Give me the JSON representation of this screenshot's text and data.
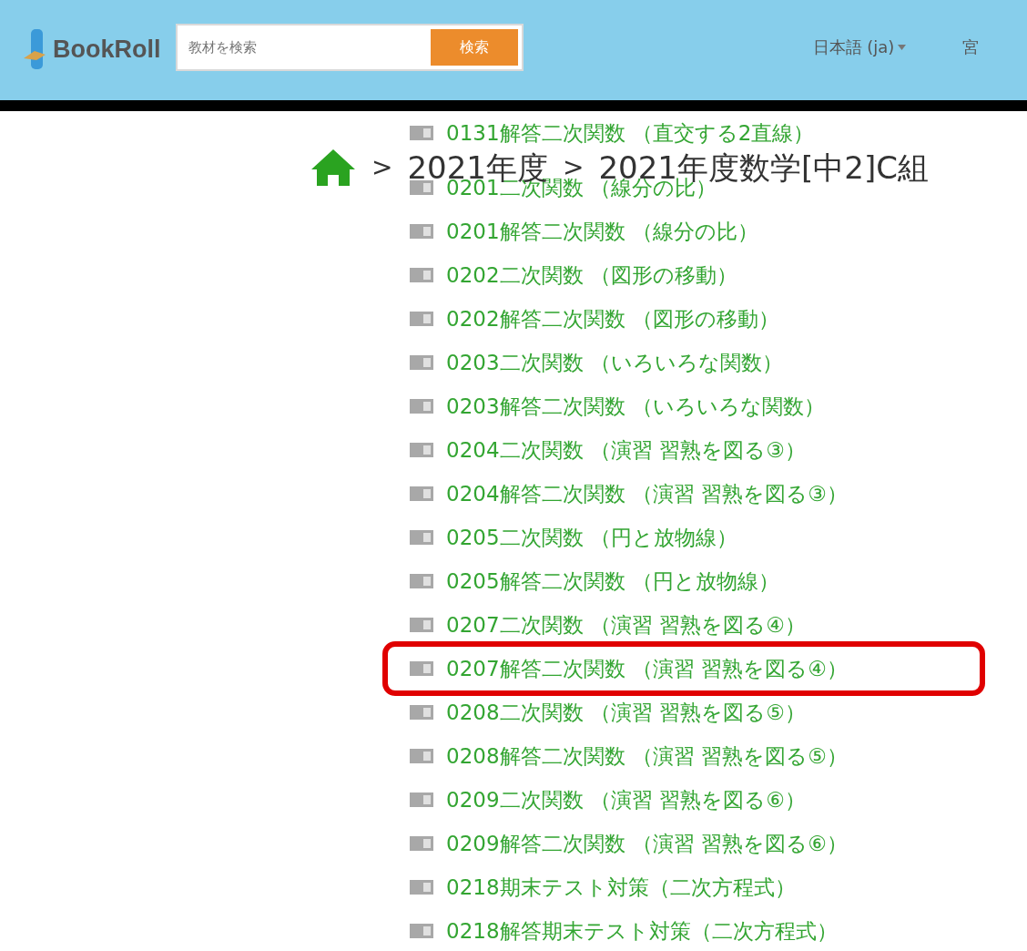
{
  "header": {
    "logo": "BookRoll",
    "search": {
      "placeholder": "教材を検索",
      "button": "検索"
    },
    "language": "日本語 (ja)",
    "user": "宮"
  },
  "breadcrumb": [
    {
      "separator": ">",
      "label": "2021年度"
    },
    {
      "separator": ">",
      "label": "2021年度数学[中2]C組"
    }
  ],
  "materials": [
    {
      "title": "0131解答二次関数 （直交する2直線）",
      "highlighted": false
    },
    {
      "title": "0201二次関数 （線分の比）",
      "highlighted": false
    },
    {
      "title": "0201解答二次関数 （線分の比）",
      "highlighted": false
    },
    {
      "title": "0202二次関数 （図形の移動）",
      "highlighted": false
    },
    {
      "title": "0202解答二次関数 （図形の移動）",
      "highlighted": false
    },
    {
      "title": "0203二次関数 （いろいろな関数）",
      "highlighted": false
    },
    {
      "title": "0203解答二次関数 （いろいろな関数）",
      "highlighted": false
    },
    {
      "title": "0204二次関数 （演習 習熟を図る③）",
      "highlighted": false
    },
    {
      "title": "0204解答二次関数 （演習 習熟を図る③）",
      "highlighted": false
    },
    {
      "title": "0205二次関数 （円と放物線）",
      "highlighted": false
    },
    {
      "title": "0205解答二次関数 （円と放物線）",
      "highlighted": false
    },
    {
      "title": "0207二次関数 （演習 習熟を図る④）",
      "highlighted": false
    },
    {
      "title": "0207解答二次関数 （演習 習熟を図る④）",
      "highlighted": true
    },
    {
      "title": "0208二次関数 （演習 習熟を図る⑤）",
      "highlighted": false
    },
    {
      "title": "0208解答二次関数 （演習 習熟を図る⑤）",
      "highlighted": false
    },
    {
      "title": "0209二次関数 （演習 習熟を図る⑥）",
      "highlighted": false
    },
    {
      "title": "0209解答二次関数 （演習 習熟を図る⑥）",
      "highlighted": false
    },
    {
      "title": "0218期末テスト対策（二次方程式）",
      "highlighted": false
    },
    {
      "title": "0218解答期末テスト対策（二次方程式）",
      "highlighted": false
    }
  ]
}
